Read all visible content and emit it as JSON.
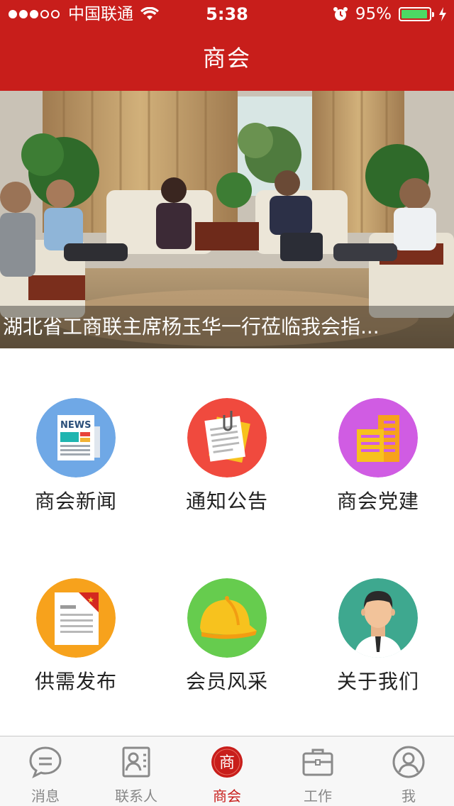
{
  "status_bar": {
    "carrier": "中国联通",
    "time": "5:38",
    "battery": "95%",
    "battery_level": 0.95
  },
  "header": {
    "title": "商会"
  },
  "banner": {
    "caption": "湖北省工商联主席杨玉华一行莅临我会指..."
  },
  "menu": [
    {
      "label": "商会新闻",
      "icon": "news-icon",
      "color": "#6fa8e6"
    },
    {
      "label": "通知公告",
      "icon": "notice-icon",
      "color": "#f04a3e"
    },
    {
      "label": "商会党建",
      "icon": "building-icon",
      "color": "#d05ce3"
    },
    {
      "label": "供需发布",
      "icon": "document-icon",
      "color": "#f7a21c"
    },
    {
      "label": "会员风采",
      "icon": "hard-hat-icon",
      "color": "#66cc4e"
    },
    {
      "label": "关于我们",
      "icon": "person-icon",
      "color": "#3ea88f"
    }
  ],
  "tabs": [
    {
      "label": "消息",
      "icon": "chat-icon"
    },
    {
      "label": "联系人",
      "icon": "contacts-icon"
    },
    {
      "label": "商会",
      "icon": "chamber-seal-icon",
      "active": true
    },
    {
      "label": "工作",
      "icon": "briefcase-icon"
    },
    {
      "label": "我",
      "icon": "user-icon"
    }
  ],
  "colors": {
    "brand_red": "#c81e1b",
    "tab_inactive": "#888888"
  }
}
